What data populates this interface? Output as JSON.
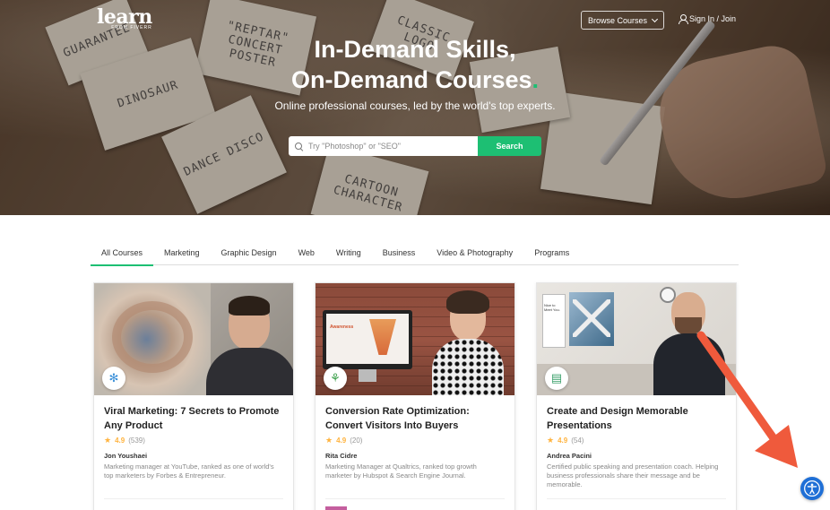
{
  "logo": {
    "main": "learn",
    "sub": "FROM FIVERR"
  },
  "header": {
    "browse_label": "Browse Courses",
    "signin_label": "Sign In / Join"
  },
  "hero": {
    "title_line1": "In-Demand Skills,",
    "title_line2": "On-Demand Courses",
    "title_dot": ".",
    "subtitle": "Online professional courses, led by the world's top experts.",
    "search_placeholder": "Try \"Photoshop\" or \"SEO\"",
    "search_button": "Search",
    "sticky_notes": [
      "GUARANTEE",
      "\"REPTAR\" CONCERT POSTER",
      "CLASSIC LOGO",
      "DINOSAUR",
      "DANCE DISCO",
      "CARTOON CHARACTER"
    ]
  },
  "tabs": [
    {
      "label": "All Courses",
      "active": true
    },
    {
      "label": "Marketing",
      "active": false
    },
    {
      "label": "Graphic Design",
      "active": false
    },
    {
      "label": "Web",
      "active": false
    },
    {
      "label": "Writing",
      "active": false
    },
    {
      "label": "Business",
      "active": false
    },
    {
      "label": "Video & Photography",
      "active": false
    },
    {
      "label": "Programs",
      "active": false
    }
  ],
  "cards": [
    {
      "title": "Viral Marketing: 7 Secrets to Promote Any Product",
      "rating": "4.9",
      "rating_count": "(539)",
      "instructor": "Jon Youshaei",
      "bio": "Marketing manager at YouTube, ranked as one of world's top marketers by Forbes & Entrepreneur.",
      "category_icon": "snowflake-icon"
    },
    {
      "title": "Conversion Rate Optimization: Convert Visitors Into Buyers",
      "rating": "4.9",
      "rating_count": "(20)",
      "instructor": "Rita Cidre",
      "bio": "Marketing Manager at Qualtrics, ranked top growth marketer by Hubspot & Search Engine Journal.",
      "category_icon": "growth-icon",
      "screen_text": "Awareness"
    },
    {
      "title": "Create and Design Memorable Presentations",
      "rating": "4.9",
      "rating_count": "(54)",
      "instructor": "Andrea Pacini",
      "bio": "Certified public speaking and presentation coach. Helping business professionals share their message and be memorable.",
      "category_icon": "presentation-icon",
      "whiteboard_text": "Nice to Meet You."
    }
  ],
  "colors": {
    "brand_green": "#1dbf73",
    "star": "#ffb33e",
    "arrow": "#ef5a3c",
    "a11y": "#1f6fd6"
  }
}
